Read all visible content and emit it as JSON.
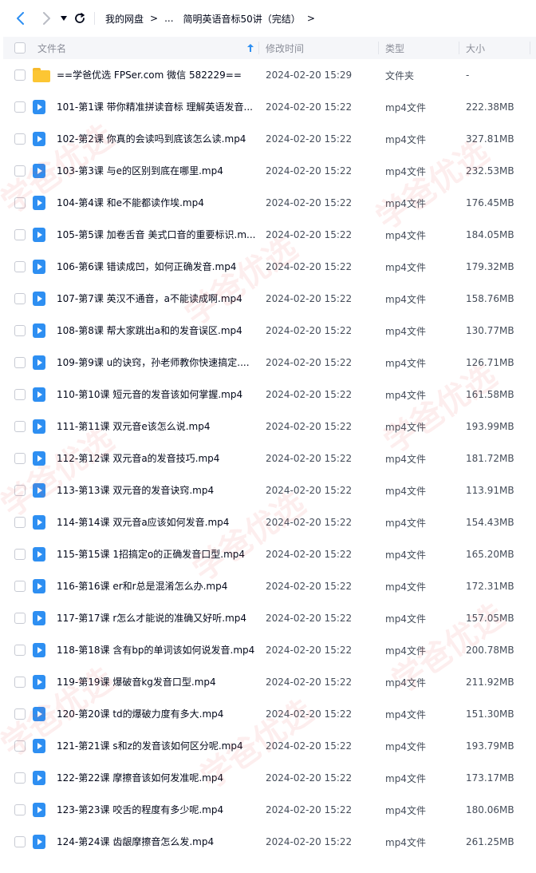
{
  "toolbar": {
    "breadcrumb": [
      "我的网盘",
      "...",
      "简明英语音标50讲（完结）"
    ]
  },
  "columns": {
    "name": "文件名",
    "modified": "修改时间",
    "type": "类型",
    "size": "大小"
  },
  "files": [
    {
      "name": "==学爸优选 FPSer.com 微信 582229==",
      "time": "2024-02-20 15:29",
      "type": "文件夹",
      "size": "-",
      "kind": "folder"
    },
    {
      "name": "101-第1课 带你精准拼读音标 理解英语发音...",
      "time": "2024-02-20 15:22",
      "type": "mp4文件",
      "size": "222.38MB",
      "kind": "video"
    },
    {
      "name": "102-第2课 你真的会读吗到底该怎么读.mp4",
      "time": "2024-02-20 15:22",
      "type": "mp4文件",
      "size": "327.81MB",
      "kind": "video"
    },
    {
      "name": "103-第3课 与e的区别到底在哪里.mp4",
      "time": "2024-02-20 15:22",
      "type": "mp4文件",
      "size": "232.53MB",
      "kind": "video"
    },
    {
      "name": "104-第4课 和e不能都读作埃.mp4",
      "time": "2024-02-20 15:22",
      "type": "mp4文件",
      "size": "176.45MB",
      "kind": "video"
    },
    {
      "name": "105-第5课 加卷舌音 美式口音的重要标识.m...",
      "time": "2024-02-20 15:22",
      "type": "mp4文件",
      "size": "184.05MB",
      "kind": "video"
    },
    {
      "name": "106-第6课 错读成凹，如何正确发音.mp4",
      "time": "2024-02-20 15:22",
      "type": "mp4文件",
      "size": "179.32MB",
      "kind": "video"
    },
    {
      "name": "107-第7课 英汉不通音，a不能读成啊.mp4",
      "time": "2024-02-20 15:22",
      "type": "mp4文件",
      "size": "158.76MB",
      "kind": "video"
    },
    {
      "name": "108-第8课 帮大家跳出a和的发音误区.mp4",
      "time": "2024-02-20 15:22",
      "type": "mp4文件",
      "size": "130.77MB",
      "kind": "video"
    },
    {
      "name": "109-第9课 u的诀窍，孙老师教你快速搞定....",
      "time": "2024-02-20 15:22",
      "type": "mp4文件",
      "size": "126.71MB",
      "kind": "video"
    },
    {
      "name": "110-第10课 短元音的发音该如何掌握.mp4",
      "time": "2024-02-20 15:22",
      "type": "mp4文件",
      "size": "161.58MB",
      "kind": "video"
    },
    {
      "name": "111-第11课 双元音e该怎么说.mp4",
      "time": "2024-02-20 15:22",
      "type": "mp4文件",
      "size": "193.99MB",
      "kind": "video"
    },
    {
      "name": "112-第12课 双元音a的发音技巧.mp4",
      "time": "2024-02-20 15:22",
      "type": "mp4文件",
      "size": "181.72MB",
      "kind": "video"
    },
    {
      "name": "113-第13课 双元音的发音诀窍.mp4",
      "time": "2024-02-20 15:22",
      "type": "mp4文件",
      "size": "113.91MB",
      "kind": "video"
    },
    {
      "name": "114-第14课 双元音a应该如何发音.mp4",
      "time": "2024-02-20 15:22",
      "type": "mp4文件",
      "size": "154.43MB",
      "kind": "video"
    },
    {
      "name": "115-第15课 1招搞定o的正确发音口型.mp4",
      "time": "2024-02-20 15:22",
      "type": "mp4文件",
      "size": "165.20MB",
      "kind": "video"
    },
    {
      "name": "116-第16课 er和r总是混淆怎么办.mp4",
      "time": "2024-02-20 15:22",
      "type": "mp4文件",
      "size": "172.31MB",
      "kind": "video"
    },
    {
      "name": "117-第17课 r怎么才能说的准确又好听.mp4",
      "time": "2024-02-20 15:22",
      "type": "mp4文件",
      "size": "157.05MB",
      "kind": "video"
    },
    {
      "name": "118-第18课 含有bp的单词该如何说发音.mp4",
      "time": "2024-02-20 15:22",
      "type": "mp4文件",
      "size": "200.78MB",
      "kind": "video"
    },
    {
      "name": "119-第19课 爆破音kg发音口型.mp4",
      "time": "2024-02-20 15:22",
      "type": "mp4文件",
      "size": "211.92MB",
      "kind": "video"
    },
    {
      "name": "120-第20课 td的爆破力度有多大.mp4",
      "time": "2024-02-20 15:22",
      "type": "mp4文件",
      "size": "151.30MB",
      "kind": "video"
    },
    {
      "name": "121-第21课 s和z的发音该如何区分呢.mp4",
      "time": "2024-02-20 15:22",
      "type": "mp4文件",
      "size": "193.79MB",
      "kind": "video"
    },
    {
      "name": "122-第22课 摩擦音该如何发准呢.mp4",
      "time": "2024-02-20 15:22",
      "type": "mp4文件",
      "size": "173.17MB",
      "kind": "video"
    },
    {
      "name": "123-第23课 咬舌的程度有多少呢.mp4",
      "time": "2024-02-20 15:22",
      "type": "mp4文件",
      "size": "180.06MB",
      "kind": "video"
    },
    {
      "name": "124-第24课 齿龈摩擦音怎么发.mp4",
      "time": "2024-02-20 15:22",
      "type": "mp4文件",
      "size": "261.25MB",
      "kind": "video"
    }
  ],
  "colors": {
    "accent": "#2e8ff2",
    "folder": "#fcc633",
    "header_bg": "#f5f6f9"
  },
  "icons": {
    "back": "back-arrow-icon",
    "forward": "forward-arrow-icon",
    "dropdown": "caret-down-icon",
    "refresh": "refresh-icon",
    "sort": "sort-up-icon"
  }
}
